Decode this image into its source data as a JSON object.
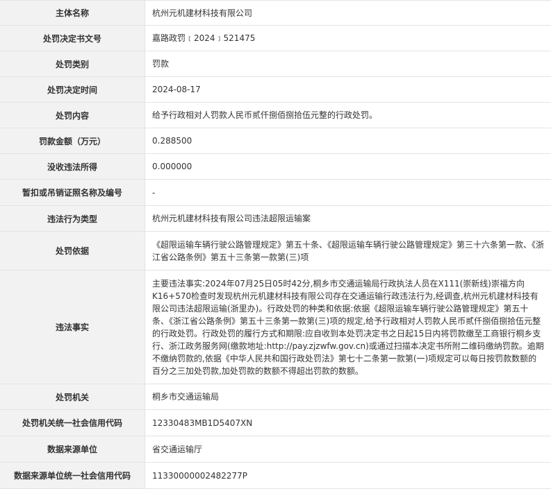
{
  "rows": [
    {
      "label": "主体名称",
      "value": "杭州元机建材科技有限公司"
    },
    {
      "label": "处罚决定书文号",
      "value": "嘉路政罚﹝2024﹞521475"
    },
    {
      "label": "处罚类别",
      "value": "罚款"
    },
    {
      "label": "处罚决定时间",
      "value": "2024-08-17"
    },
    {
      "label": "处罚内容",
      "value": "给予行政相对人罚款人民币贰仟捌佰捌拾伍元整的行政处罚。"
    },
    {
      "label": "罚款金额（万元）",
      "value": "0.288500"
    },
    {
      "label": "没收违法所得",
      "value": "0.000000"
    },
    {
      "label": "暂扣或吊销证照名称及编号",
      "value": "-"
    },
    {
      "label": "违法行为类型",
      "value": "杭州元机建材科技有限公司违法超限运输案"
    },
    {
      "label": "处罚依据",
      "value": "《超限运输车辆行驶公路管理规定》第五十条、《超限运输车辆行驶公路管理规定》第三十六条第一款、《浙江省公路条例》第五十三条第一款第(三)项"
    },
    {
      "label": "违法事实",
      "value": "主要违法事实:2024年07月25日05时42分,桐乡市交通运输局行政执法人员在X111(崇新线)崇福方向K16+570检查时发现杭州元机建材科技有限公司存在交通运输行政违法行为,经调查,杭州元机建材科技有限公司违法超限运输(浙里办)。行政处罚的种类和依据:依据《超限运输车辆行驶公路管理规定》第五十条、《浙江省公路条例》第五十三条第一款第(三)项的规定,给予行政相对人罚款人民币贰仟捌佰捌拾伍元整的行政处罚。行政处罚的履行方式和期限:应自收到本处罚决定书之日起15日内将罚款缴至工商银行桐乡支行、浙江政务服务网(缴款地址:http://pay.zjzwfw.gov.cn)或通过扫描本决定书所附二维码缴纳罚款。逾期不缴纳罚款的,依据《中华人民共和国行政处罚法》第七十二条第一款第(一)项规定可以每日按罚款数额的百分之三加处罚款,加处罚款的数额不得超出罚款的数额。"
    },
    {
      "label": "处罚机关",
      "value": "桐乡市交通运输局"
    },
    {
      "label": "处罚机关统一社会信用代码",
      "value": "12330483MB1D5407XN"
    },
    {
      "label": "数据来源单位",
      "value": "省交通运输厅"
    },
    {
      "label": "数据来源单位统一社会信用代码",
      "value": "11330000002482277P"
    }
  ]
}
